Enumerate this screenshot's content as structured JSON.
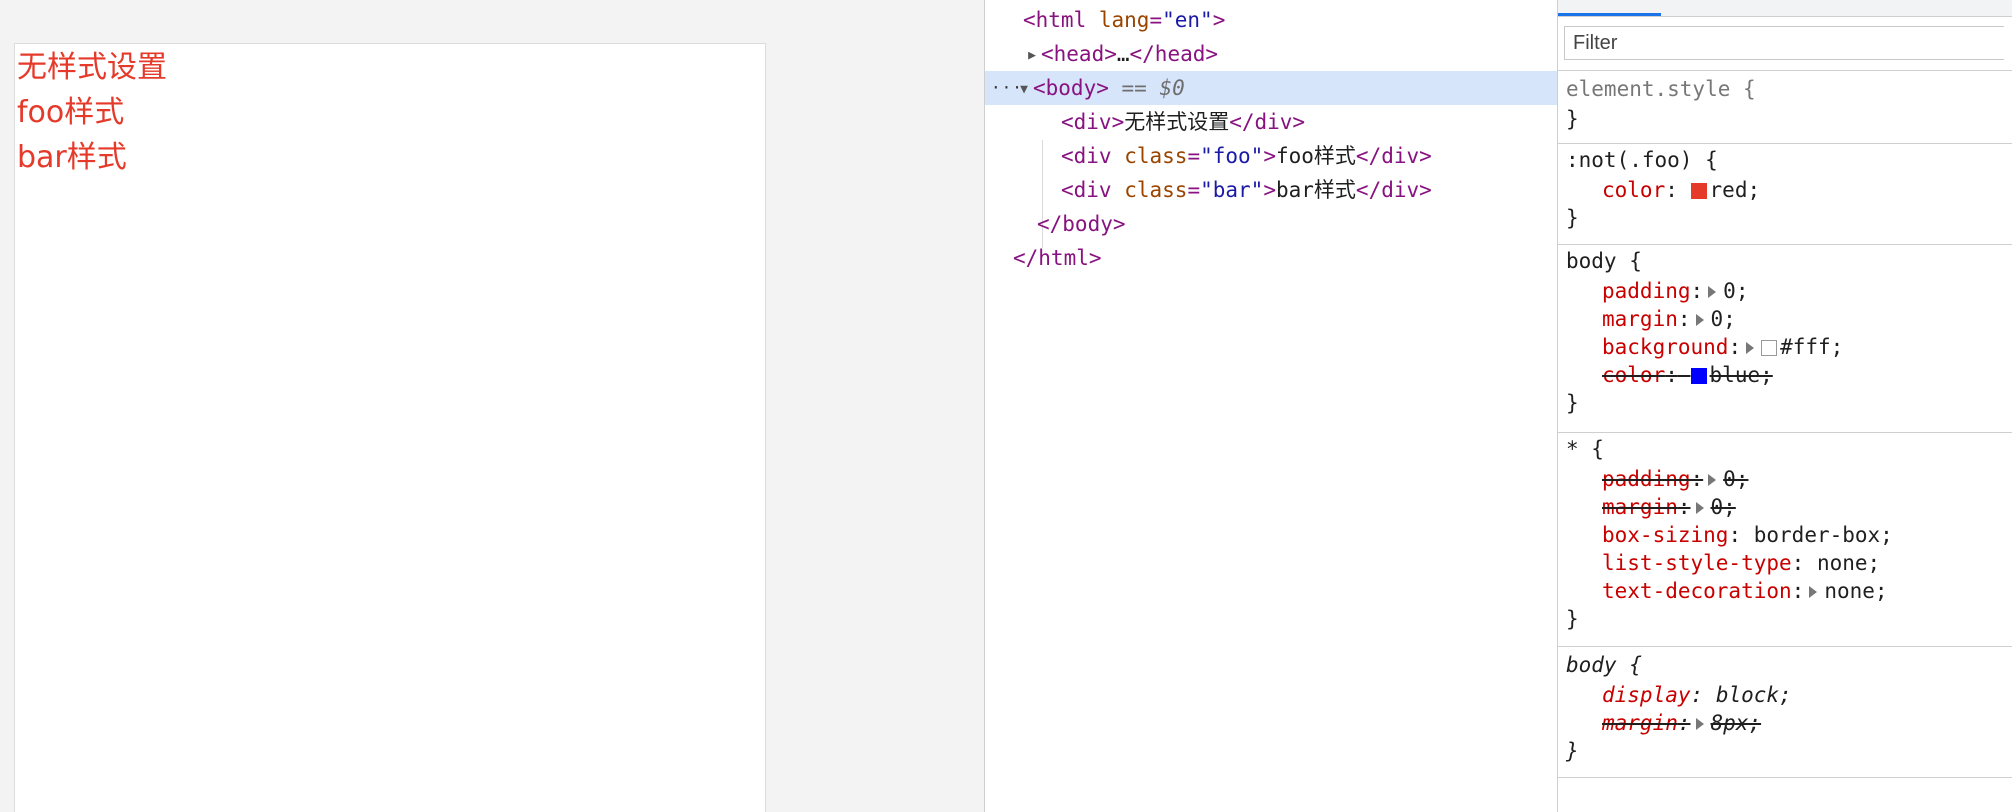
{
  "preview": {
    "lines": [
      "无样式设置",
      "foo样式",
      "bar样式"
    ],
    "text_color": "#e53a2a"
  },
  "elements": {
    "html_open": {
      "tag": "<html",
      "attr": "lang",
      "eq": "=",
      "val": "\"en\"",
      "close": ">"
    },
    "head": {
      "open": "<head>",
      "ellipsis": "…",
      "close": "</head>"
    },
    "body": {
      "dots": "···",
      "open": "<body>",
      "eq": " == ",
      "ref": "$0"
    },
    "div1": {
      "open": "<div>",
      "text": "无样式设置",
      "close": "</div>"
    },
    "div2": {
      "tag": "<div",
      "attr": "class",
      "eq": "=",
      "val": "\"foo\"",
      "gt": ">",
      "text": "foo样式",
      "close": "</div>"
    },
    "div3": {
      "tag": "<div",
      "attr": "class",
      "eq": "=",
      "val": "\"bar\"",
      "gt": ">",
      "text": "bar样式",
      "close": "</div>"
    },
    "body_close": "</body>",
    "html_close": "</html>"
  },
  "styles": {
    "filter_placeholder": "Filter",
    "rules": [
      {
        "selector": "element.style {",
        "close": "}"
      },
      {
        "selector": ":not(.foo) {",
        "close": "}",
        "props": [
          {
            "name": "color",
            "value": "red;",
            "swatch": "#e53a2a"
          }
        ]
      },
      {
        "selector": "body {",
        "close": "}",
        "props": [
          {
            "name": "padding",
            "value": "0;",
            "expand": true
          },
          {
            "name": "margin",
            "value": "0;",
            "expand": true
          },
          {
            "name": "background",
            "value": "#fff;",
            "expand": true,
            "swatch": "#ffffff"
          },
          {
            "name": "color",
            "value": "blue;",
            "swatch": "#0000ff",
            "struck": true
          }
        ]
      },
      {
        "selector": "* {",
        "close": "}",
        "props": [
          {
            "name": "padding",
            "value": "0;",
            "expand": true,
            "struck": true
          },
          {
            "name": "margin",
            "value": "0;",
            "expand": true,
            "struck": true
          },
          {
            "name": "box-sizing",
            "value": "border-box;"
          },
          {
            "name": "list-style-type",
            "value": "none;"
          },
          {
            "name": "text-decoration",
            "value": "none;",
            "expand": true
          }
        ]
      },
      {
        "selector": "body {",
        "close": "}",
        "props": [
          {
            "name": "display",
            "value": "block;"
          },
          {
            "name": "margin",
            "value": "8px;",
            "expand": true,
            "struck": true
          }
        ]
      }
    ],
    "colon": ":"
  },
  "colors": {
    "selected_row": "#d7e5fb",
    "tag": "#881280",
    "attr_name": "#994500",
    "attr_value": "#1a1aa6",
    "prop_name": "#c80000",
    "active_tab": "#1a73e8"
  }
}
